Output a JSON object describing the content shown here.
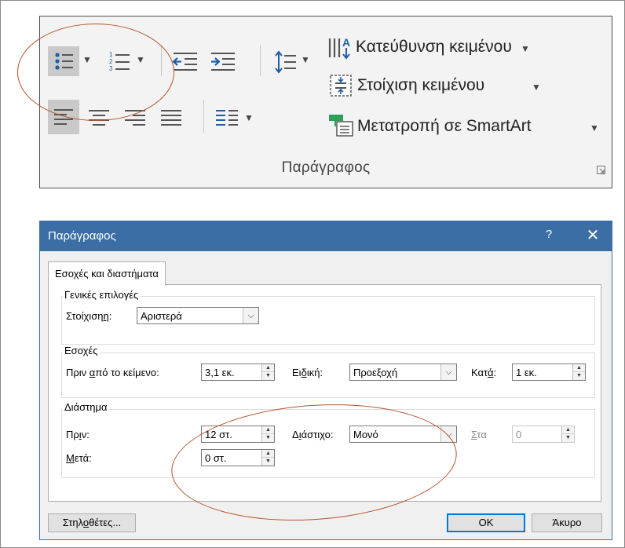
{
  "ribbon": {
    "text_direction_label": "Κατεύθυνση κειμένου",
    "align_text_label": "Στοίχιση κειμένου",
    "smartart_label": "Μετατροπή σε SmartArt",
    "group_label": "Παράγραφος",
    "icons": [
      "bullets-icon",
      "numbering-icon",
      "decrease-indent-icon",
      "increase-indent-icon",
      "line-spacing-icon",
      "text-direction-icon",
      "align-text-icon",
      "smartart-icon",
      "align-left-icon",
      "center-icon",
      "align-right-icon",
      "justify-icon",
      "columns-icon",
      "dialog-launcher-icon"
    ]
  },
  "dialog": {
    "title": "Παράγραφος",
    "help": "?",
    "close": "✕",
    "tab_label": "Εσοχές και διαστήματα",
    "general": {
      "title": "Γενικές επιλογές",
      "alignment_label_pre": "Στοίχιση",
      "alignment_label_u": "η",
      "alignment_label_post": ":",
      "alignment_value": "Αριστερά"
    },
    "indents": {
      "title": "Εσοχές",
      "before_label_pre": "Πριν ",
      "before_label_u": "α",
      "before_label_post": "πό το κείμενο:",
      "before_value": "3,1 εκ.",
      "special_label_pre": "Ει",
      "special_label_u": "δ",
      "special_label_post": "ική:",
      "special_value": "Προεξοχή",
      "by_label_pre": "Κατ",
      "by_label_u": "ά",
      "by_label_post": ":",
      "by_value": "1 εκ."
    },
    "spacing": {
      "title": "Διάστημα",
      "before_label_pre": "Πρ",
      "before_label_u": "ι",
      "before_label_post": "ν:",
      "before_value": "12 στ.",
      "after_label_pre": "",
      "after_label_u": "Μ",
      "after_label_post": "ετά:",
      "after_value": "0 στ.",
      "line_label_pre": "Δ",
      "line_label_u": "ι",
      "line_label_post": "άστιχο:",
      "line_value": "Μονό",
      "at_label_u": "Σ",
      "at_label_post": "τα",
      "at_value": "0"
    },
    "buttons": {
      "tabs_pre": "Στηλ",
      "tabs_u": "ο",
      "tabs_post": "θέτες...",
      "ok": "OK",
      "cancel": "Άκυρο"
    }
  },
  "colors": {
    "title_bar": "#3a6ea5",
    "highlight_ellipse": "#b5532a",
    "selected_button": "#c9c9c9"
  }
}
